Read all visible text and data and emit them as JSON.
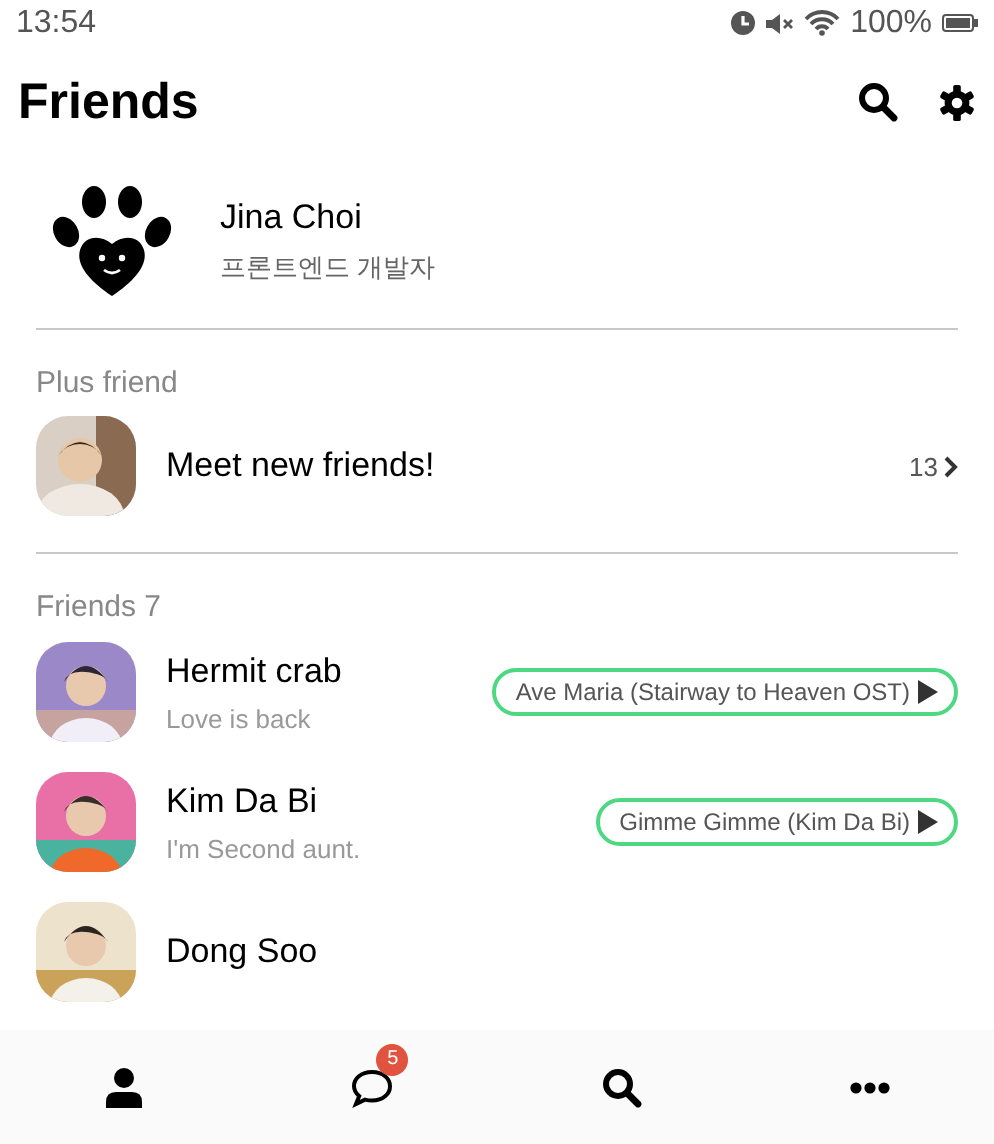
{
  "status_bar": {
    "time": "13:54",
    "battery": "100%"
  },
  "header": {
    "title": "Friends"
  },
  "profile": {
    "name": "Jina Choi",
    "status": "프론트엔드 개발자"
  },
  "plus_friend": {
    "heading": "Plus friend",
    "label": "Meet new friends!",
    "count": "13"
  },
  "friends": {
    "heading": "Friends 7",
    "items": [
      {
        "name": "Hermit crab",
        "status": "Love is back",
        "music": "Ave Maria (Stairway to Heaven OST)"
      },
      {
        "name": "Kim Da Bi",
        "status": "I'm Second aunt.",
        "music": "Gimme Gimme (Kim Da Bi)"
      },
      {
        "name": "Dong Soo"
      }
    ]
  },
  "tab_bar": [
    {
      "kind": "person"
    },
    {
      "kind": "chat",
      "badge": "5"
    },
    {
      "kind": "search"
    },
    {
      "kind": "more"
    }
  ]
}
